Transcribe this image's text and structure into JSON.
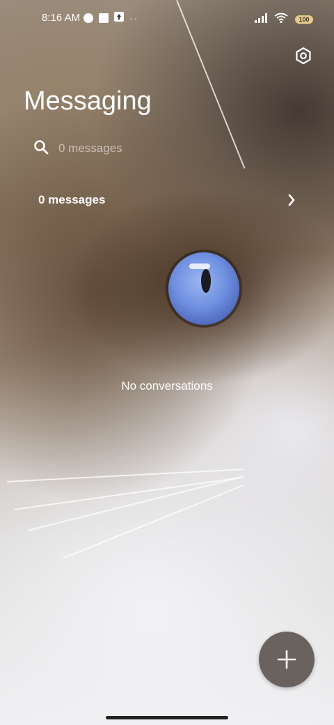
{
  "status_bar": {
    "time": "8:16 AM",
    "battery": "100",
    "icons_left": [
      "data-saver-icon",
      "notification-square-icon",
      "upload-icon",
      "more-dots-icon"
    ],
    "icons_right": [
      "signal-icon",
      "wifi-icon",
      "battery-icon"
    ]
  },
  "header": {
    "title": "Messaging",
    "settings_icon": "settings-hexagon-icon"
  },
  "search": {
    "placeholder": "0 messages",
    "icon": "search-icon"
  },
  "messages_row": {
    "label": "0 messages",
    "icon": "chevron-right-icon"
  },
  "main": {
    "empty_text": "No conversations"
  },
  "fab": {
    "icon": "plus-icon"
  },
  "colors": {
    "fab_bg": "#6a625e",
    "text": "#ffffff"
  }
}
